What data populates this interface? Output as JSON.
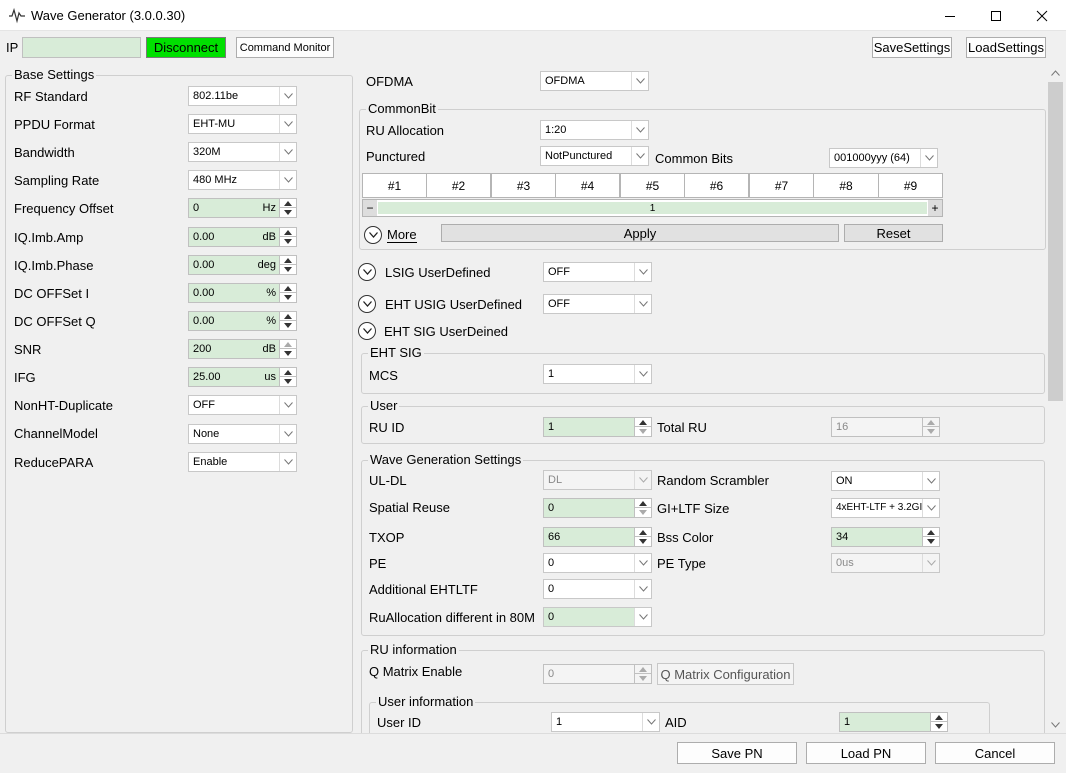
{
  "window": {
    "title": "Wave Generator (3.0.0.30)"
  },
  "top": {
    "ip_label": "IP",
    "ip_value": "",
    "disconnect": "Disconnect",
    "command_monitor": "Command Monitor",
    "save_settings": "SaveSettings",
    "load_settings": "LoadSettings"
  },
  "base": {
    "title": "Base Settings",
    "rows": [
      {
        "label": "RF Standard",
        "value": "802.11be"
      },
      {
        "label": "PPDU Format",
        "value": "EHT-MU"
      },
      {
        "label": "Bandwidth",
        "value": "320M"
      },
      {
        "label": "Sampling Rate",
        "value": "480 MHz"
      },
      {
        "label": "Frequency Offset",
        "value": "0",
        "unit": "Hz"
      },
      {
        "label": "IQ.Imb.Amp",
        "value": "0.00",
        "unit": "dB"
      },
      {
        "label": "IQ.Imb.Phase",
        "value": "0.00",
        "unit": "deg"
      },
      {
        "label": "DC OFFSet I",
        "value": "0.00",
        "unit": "%"
      },
      {
        "label": "DC OFFSet Q",
        "value": "0.00",
        "unit": "%"
      },
      {
        "label": "SNR",
        "value": "200",
        "unit": "dB"
      },
      {
        "label": "IFG",
        "value": "25.00",
        "unit": "us"
      },
      {
        "label": "NonHT-Duplicate",
        "value": "OFF"
      },
      {
        "label": "ChannelModel",
        "value": "None"
      },
      {
        "label": "ReducePARA",
        "value": "Enable"
      }
    ]
  },
  "right": {
    "ofdma_label": "OFDMA",
    "ofdma_value": "OFDMA",
    "common_bit": {
      "title": "CommonBit",
      "ru_alloc_label": "RU Allocation",
      "ru_alloc_value": "1:20",
      "punctured_label": "Punctured",
      "punctured_value": "NotPunctured",
      "common_bits_label": "Common Bits",
      "common_bits_value": "001000yyy (64)",
      "tabs": [
        "#1",
        "#2",
        "#3",
        "#4",
        "#5",
        "#6",
        "#7",
        "#8",
        "#9"
      ],
      "slider_minus": "−",
      "slider_plus": "+",
      "slider_value": "1",
      "more": "More",
      "apply": "Apply",
      "reset": "Reset"
    },
    "lsig_label": "LSIG UserDefined",
    "lsig_value": "OFF",
    "usig_label": "EHT USIG UserDefined",
    "usig_value": "OFF",
    "ehtsig_ud_label": "EHT SIG UserDeined",
    "eht_sig": {
      "title": "EHT SIG",
      "mcs_label": "MCS",
      "mcs_value": "1"
    },
    "user": {
      "title": "User",
      "ru_id_label": "RU ID",
      "ru_id_value": "1",
      "total_ru_label": "Total RU",
      "total_ru_value": "16"
    },
    "wave": {
      "title": "Wave Generation Settings",
      "uldl_label": "UL-DL",
      "uldl_value": "DL",
      "scrambler_label": "Random Scrambler",
      "scrambler_value": "ON",
      "spatial_label": "Spatial Reuse",
      "spatial_value": "0",
      "giltf_label": "GI+LTF Size",
      "giltf_value": "4xEHT-LTF + 3.2GI",
      "txop_label": "TXOP",
      "txop_value": "66",
      "bss_label": "Bss Color",
      "bss_value": "34",
      "pe_label": "PE",
      "pe_value": "0",
      "petype_label": "PE Type",
      "petype_value": "0us",
      "addltf_label": "Additional EHTLTF",
      "addltf_value": "0",
      "ruadiff_label": "RuAllocation different in 80M",
      "ruadiff_value": "0"
    },
    "ru_info": {
      "title": "RU information",
      "qmatrix_label": "Q Matrix Enable",
      "qmatrix_value": "0",
      "qmatrix_config": "Q Matrix Configuration",
      "user_info_title": "User information",
      "user_id_label": "User ID",
      "user_id_value": "1",
      "aid_label": "AID",
      "aid_value": "1"
    }
  },
  "bottom": {
    "save_pn": "Save PN",
    "load_pn": "Load PN",
    "cancel": "Cancel"
  },
  "colors": {
    "connected_green": "#00e000",
    "field_green": "#d8ecd8"
  },
  "icons": {
    "app": "waveform-icon",
    "arrow": "chevron-down-icon",
    "expander": "circle-chevron-icon"
  }
}
